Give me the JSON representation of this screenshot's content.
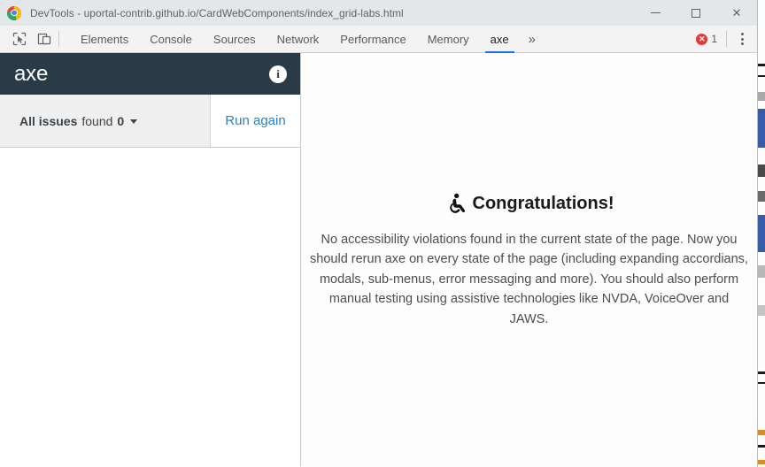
{
  "window": {
    "title": "DevTools - uportal-contrib.github.io/CardWebComponents/index_grid-labs.html",
    "logo_name": "chrome-logo",
    "controls": {
      "minimize": "—",
      "maximize": "□",
      "close": "✕"
    }
  },
  "toolbar": {
    "inspect_icon": "inspect-element-icon",
    "device_icon": "device-toolbar-icon",
    "tabs": [
      {
        "label": "Elements",
        "active": false
      },
      {
        "label": "Console",
        "active": false
      },
      {
        "label": "Sources",
        "active": false
      },
      {
        "label": "Network",
        "active": false
      },
      {
        "label": "Performance",
        "active": false
      },
      {
        "label": "Memory",
        "active": false
      },
      {
        "label": "axe",
        "active": true
      }
    ],
    "more_tabs": "»",
    "error_badge": {
      "icon_glyph": "✕",
      "count": "1",
      "color": "#e53935"
    },
    "menu_icon": "kebab-menu-icon"
  },
  "sidebar": {
    "header": {
      "logo_text": "axe",
      "info_icon_glyph": "i",
      "background": "#2a3b47"
    },
    "filter": {
      "prefix": "All issues",
      "middle": "found",
      "count": "0",
      "caret": "▾"
    },
    "run_again_label": "Run again",
    "run_again_color": "#2f7fc4",
    "issues": []
  },
  "main": {
    "icon_name": "accessible-person-icon",
    "title": "Congratulations!",
    "body": "No accessibility violations found in the current state of the page. Now you should rerun axe on every state of the page (including expanding accordians, modals, sub-menus, error messaging and more). You should also perform manual testing using assistive technologies like NVDA, VoiceOver and JAWS."
  },
  "background_window": {
    "visible": true,
    "stripe_colors": [
      "#3a5ba8",
      "#4a4a4a",
      "#3a5ba8",
      "#1a1a1a",
      "#d98e25",
      "#1a1a1a"
    ]
  }
}
